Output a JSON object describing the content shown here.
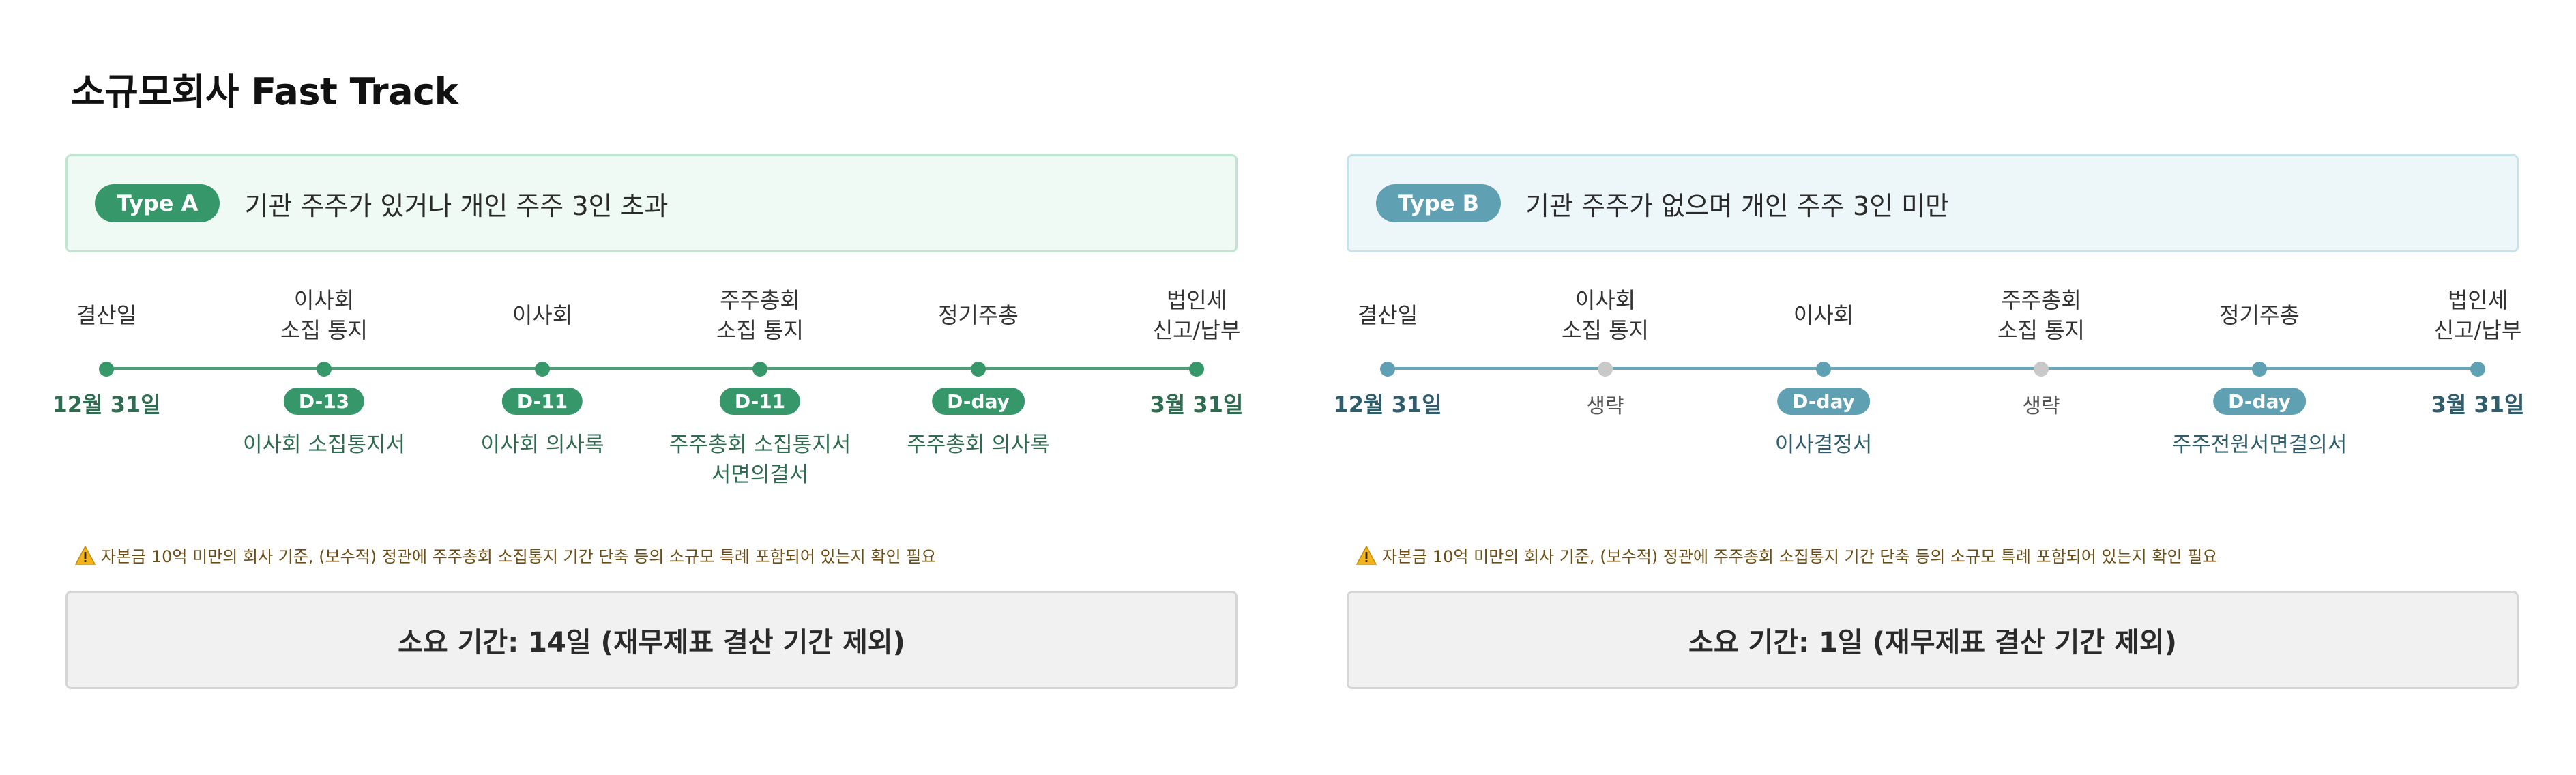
{
  "page": {
    "title": "소규모회사 Fast Track"
  },
  "colors": {
    "type_a_accent": "#36976a",
    "type_b_accent": "#5fa0b3",
    "skip_dot": "#c9c9c9"
  },
  "panels": [
    {
      "badge": "Type A",
      "description": "기관 주주가 있거나 개인 주주 3인 초과",
      "steps": [
        {
          "label_lines": [
            "결산일"
          ],
          "date": "12월 31일"
        },
        {
          "label_lines": [
            "이사회",
            "소집 통지"
          ],
          "badge": "D-13",
          "docs": [
            "이사회 소집통지서"
          ]
        },
        {
          "label_lines": [
            "이사회"
          ],
          "badge": "D-11",
          "docs": [
            "이사회 의사록"
          ]
        },
        {
          "label_lines": [
            "주주총회",
            "소집 통지"
          ],
          "badge": "D-11",
          "docs": [
            "주주총회 소집통지서",
            "서면의결서"
          ]
        },
        {
          "label_lines": [
            "정기주총"
          ],
          "badge": "D-day",
          "docs": [
            "주주총회 의사록"
          ]
        },
        {
          "label_lines": [
            "법인세",
            "신고/납부"
          ],
          "date": "3월 31일"
        }
      ],
      "warning": "자본금 10억 미만의 회사 기준, (보수적) 정관에 주주총회 소집통지 기간 단축 등의 소규모 특례 포함되어 있는지 확인 필요",
      "duration": "소요 기간: 14일 (재무제표 결산 기간 제외)"
    },
    {
      "badge": "Type B",
      "description": "기관 주주가 없으며 개인 주주 3인 미만",
      "steps": [
        {
          "label_lines": [
            "결산일"
          ],
          "date": "12월 31일"
        },
        {
          "label_lines": [
            "이사회",
            "소집 통지"
          ],
          "skip": "생략"
        },
        {
          "label_lines": [
            "이사회"
          ],
          "badge": "D-day",
          "docs": [
            "이사결정서"
          ]
        },
        {
          "label_lines": [
            "주주총회",
            "소집 통지"
          ],
          "skip": "생략"
        },
        {
          "label_lines": [
            "정기주총"
          ],
          "badge": "D-day",
          "docs": [
            "주주전원서면결의서"
          ]
        },
        {
          "label_lines": [
            "법인세",
            "신고/납부"
          ],
          "date": "3월 31일"
        }
      ],
      "warning": "자본금 10억 미만의 회사 기준, (보수적) 정관에 주주총회 소집통지 기간 단축 등의 소규모 특례 포함되어 있는지 확인 필요",
      "duration": "소요 기간: 1일 (재무제표 결산 기간 제외)"
    }
  ]
}
